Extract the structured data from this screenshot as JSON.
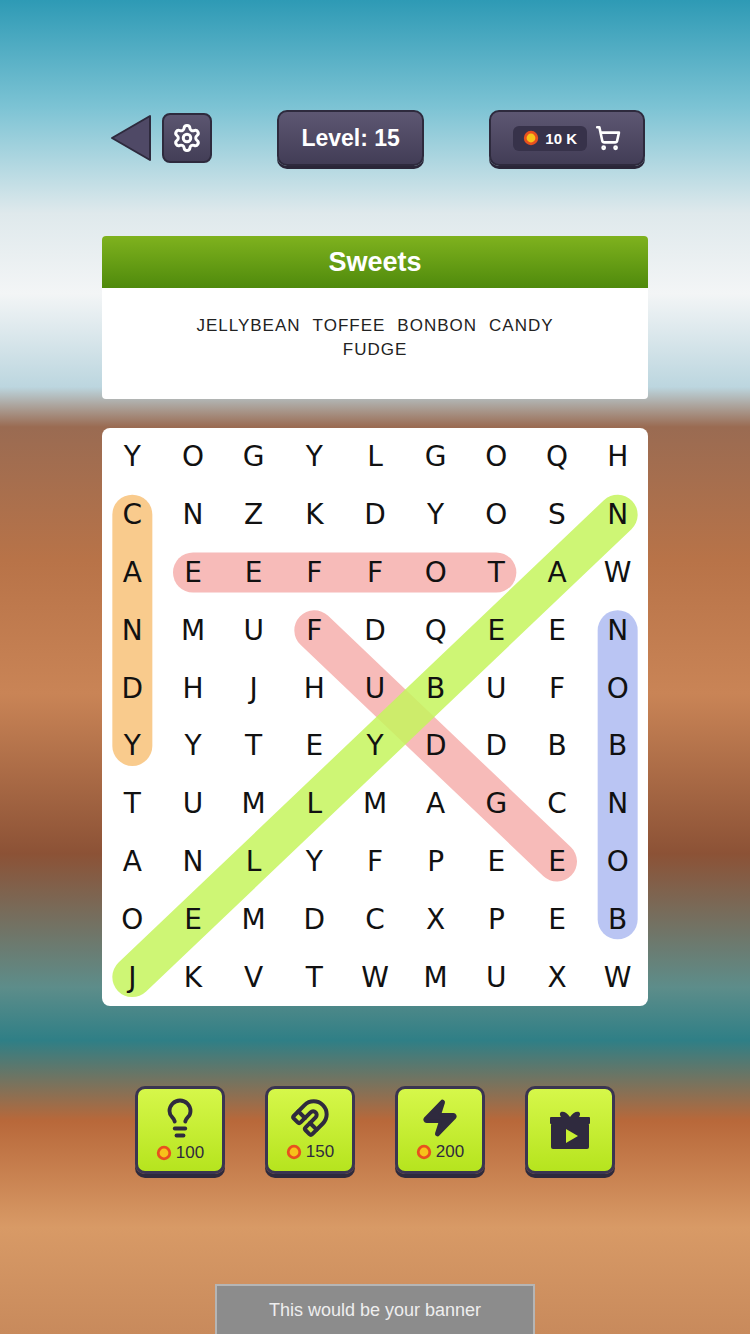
{
  "top_bar": {
    "level": "Level: 15",
    "coins": "10 K"
  },
  "category": {
    "title": "Sweets",
    "words": [
      "JELLYBEAN",
      "TOFFEE",
      "BONBON",
      "CANDY",
      "FUDGE"
    ]
  },
  "grid": {
    "rows": [
      [
        "Y",
        "O",
        "G",
        "Y",
        "L",
        "G",
        "O",
        "Q",
        "H"
      ],
      [
        "C",
        "N",
        "Z",
        "K",
        "D",
        "Y",
        "O",
        "S",
        "N"
      ],
      [
        "A",
        "E",
        "E",
        "F",
        "F",
        "O",
        "T",
        "A",
        "W"
      ],
      [
        "N",
        "M",
        "U",
        "F",
        "D",
        "Q",
        "E",
        "E",
        "N"
      ],
      [
        "D",
        "H",
        "J",
        "H",
        "U",
        "B",
        "U",
        "F",
        "O"
      ],
      [
        "Y",
        "Y",
        "T",
        "E",
        "Y",
        "D",
        "D",
        "B",
        "B"
      ],
      [
        "T",
        "U",
        "M",
        "L",
        "M",
        "A",
        "G",
        "C",
        "N"
      ],
      [
        "A",
        "N",
        "L",
        "Y",
        "F",
        "P",
        "E",
        "E",
        "O"
      ],
      [
        "O",
        "E",
        "M",
        "D",
        "C",
        "X",
        "P",
        "E",
        "B"
      ],
      [
        "J",
        "K",
        "V",
        "T",
        "W",
        "M",
        "U",
        "X",
        "W"
      ]
    ]
  },
  "found": [
    {
      "from": [
        1,
        0
      ],
      "to": [
        5,
        0
      ],
      "color": "#f9c27a"
    },
    {
      "from": [
        2,
        1
      ],
      "to": [
        2,
        6
      ],
      "color": "#f6b0ad"
    },
    {
      "from": [
        3,
        8
      ],
      "to": [
        8,
        8
      ],
      "color": "#aebcf2"
    },
    {
      "from": [
        3,
        3
      ],
      "to": [
        7,
        7
      ],
      "color": "#f6b0ad"
    },
    {
      "from": [
        9,
        0
      ],
      "to": [
        1,
        8
      ],
      "color": "#c6f55e"
    }
  ],
  "boosters": [
    {
      "kind": "hint",
      "cost": "100"
    },
    {
      "kind": "magnet",
      "cost": "150"
    },
    {
      "kind": "bolt",
      "cost": "200"
    },
    {
      "kind": "gift"
    }
  ],
  "banner": {
    "text": "This would be your banner"
  }
}
